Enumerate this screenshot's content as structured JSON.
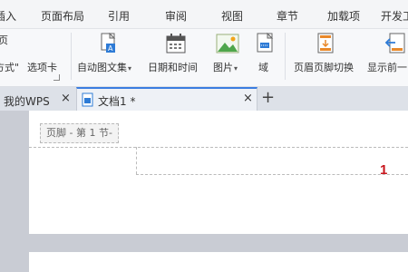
{
  "ribbon": {
    "tabs": [
      "插入",
      "页面布局",
      "引用",
      "审阅",
      "视图",
      "章节",
      "加载项",
      "开发工"
    ]
  },
  "toolbar": {
    "left_top": "页",
    "left_bottom_1": "方式\"",
    "left_bottom_2": "选项卡",
    "auto_text": "自动图文集",
    "datetime": "日期和时间",
    "picture": "图片",
    "field": "域",
    "header_footer_switch": "页眉页脚切换",
    "show_prev": "显示前一"
  },
  "doc_tabs": {
    "my_wps": "我的WPS",
    "doc1": "文档1 *"
  },
  "document": {
    "footer_tag": "页脚 - 第 1 节-",
    "page_number": "1"
  },
  "colors": {
    "accent": "#3b7de0",
    "page_number": "#c8161d"
  }
}
